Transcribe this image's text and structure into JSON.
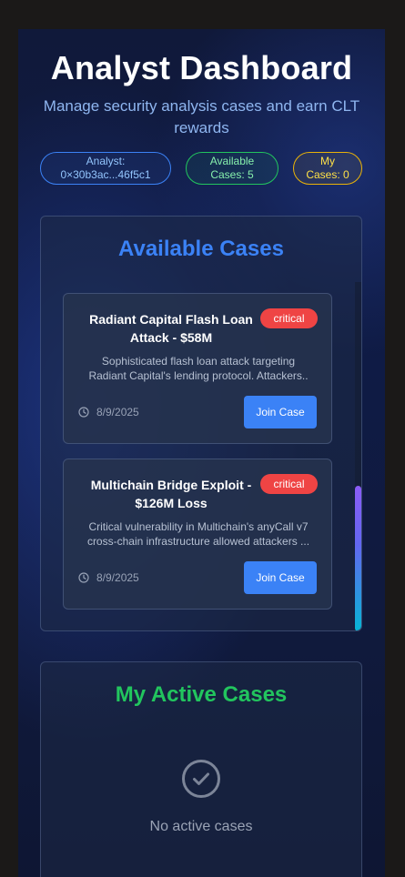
{
  "header": {
    "title": "Analyst Dashboard",
    "subtitle": "Manage security analysis cases and earn CLT rewards"
  },
  "stats": {
    "analyst_line1": "Analyst:",
    "analyst_line2": "0×30b3ac...46f5c1",
    "available_line1": "Available",
    "available_line2": "Cases: 5",
    "my_line1": "My",
    "my_line2": "Cases: 0"
  },
  "available_cases": {
    "title": "Available Cases",
    "join_label": "Join Case",
    "items": [
      {
        "title": "Radiant Capital Flash Loan Attack - $58M",
        "severity": "critical",
        "description_line1": "Sophisticated flash loan attack targeting",
        "description_line2": "Radiant Capital's lending protocol. Attackers..",
        "date": "8/9/2025"
      },
      {
        "title": "Multichain Bridge Exploit - $126M Loss",
        "severity": "critical",
        "description_line1": "Critical vulnerability in Multichain's anyCall v7",
        "description_line2": "cross-chain infrastructure allowed attackers ...",
        "date": "8/9/2025"
      }
    ]
  },
  "active_cases": {
    "title": "My Active Cases",
    "empty_text": "No active cases"
  },
  "colors": {
    "accent_blue": "#3b82f6",
    "accent_green": "#22c55e",
    "accent_yellow": "#eab308",
    "critical_red": "#ef4444"
  },
  "icons": {
    "date": "clock-icon",
    "empty": "check-circle-icon"
  }
}
